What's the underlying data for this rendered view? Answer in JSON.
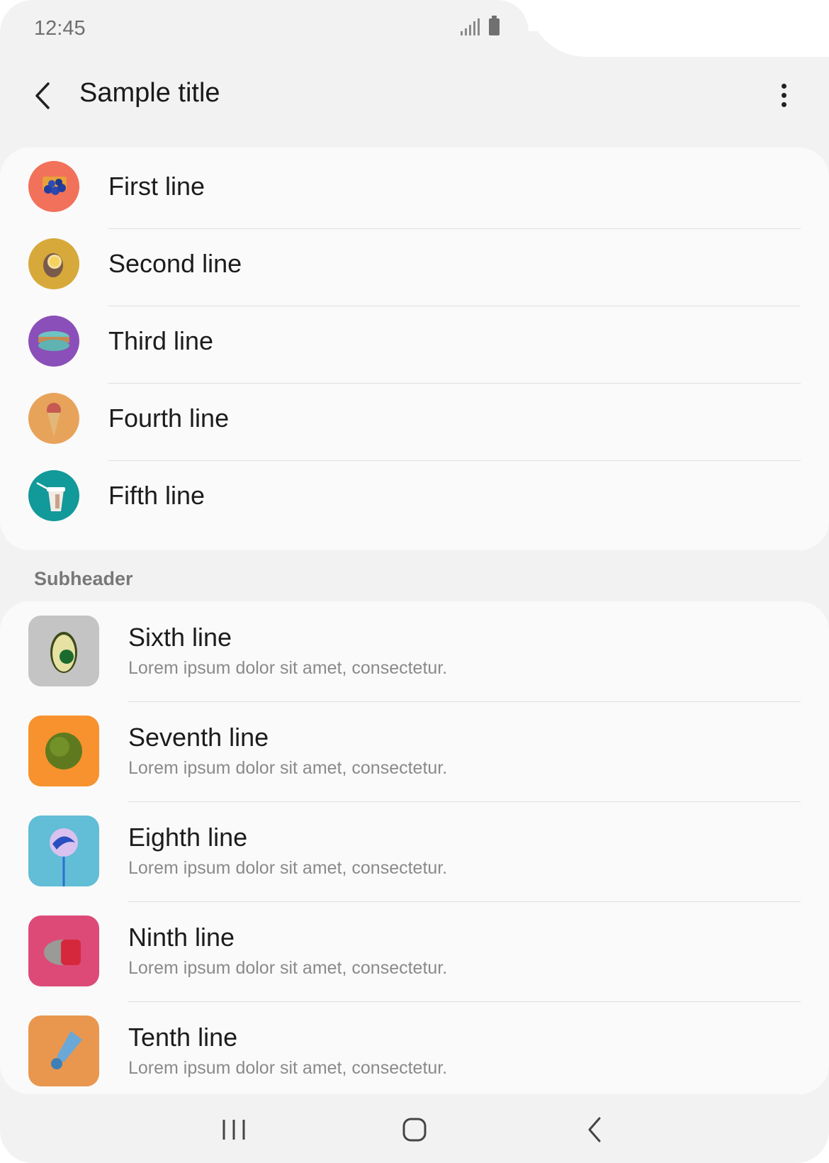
{
  "status_bar": {
    "time": "12:45",
    "signal_icon": "signal-icon",
    "battery_icon": "battery-icon"
  },
  "app_bar": {
    "back_icon": "chevron-left-icon",
    "title": "Sample title",
    "more_icon": "more-vertical-icon"
  },
  "list_group_1": [
    {
      "label": "First line",
      "icon": "blueberries-icon",
      "color": "#f2715a"
    },
    {
      "label": "Second line",
      "icon": "lemon-icon",
      "color": "#d7a93a"
    },
    {
      "label": "Third line",
      "icon": "macaron-icon",
      "color": "#8a4fb8"
    },
    {
      "label": "Fourth line",
      "icon": "ice-cream-icon",
      "color": "#e8a35a"
    },
    {
      "label": "Fifth line",
      "icon": "cup-icon",
      "color": "#12999a"
    }
  ],
  "subheader": "Subheader",
  "list_group_2": [
    {
      "label": "Sixth line",
      "subtitle": "Lorem ipsum dolor sit amet, consectetur.",
      "icon": "avocado-icon",
      "color": "#c4c4c4"
    },
    {
      "label": "Seventh line",
      "subtitle": "Lorem ipsum dolor sit amet, consectetur.",
      "icon": "moss-ball-icon",
      "color": "#f7922e"
    },
    {
      "label": "Eighth line",
      "subtitle": "Lorem ipsum dolor sit amet, consectetur.",
      "icon": "lollipop-icon",
      "color": "#62bdd6"
    },
    {
      "label": "Ninth line",
      "subtitle": "Lorem ipsum dolor sit amet, consectetur.",
      "icon": "stone-icon",
      "color": "#dd4a78"
    },
    {
      "label": "Tenth line",
      "subtitle": "Lorem ipsum dolor sit amet, consectetur.",
      "icon": "shuttlecock-icon",
      "color": "#e9974e"
    }
  ],
  "nav_bar": {
    "recents_icon": "recents-icon",
    "home_icon": "home-icon",
    "back_icon": "back-icon"
  }
}
